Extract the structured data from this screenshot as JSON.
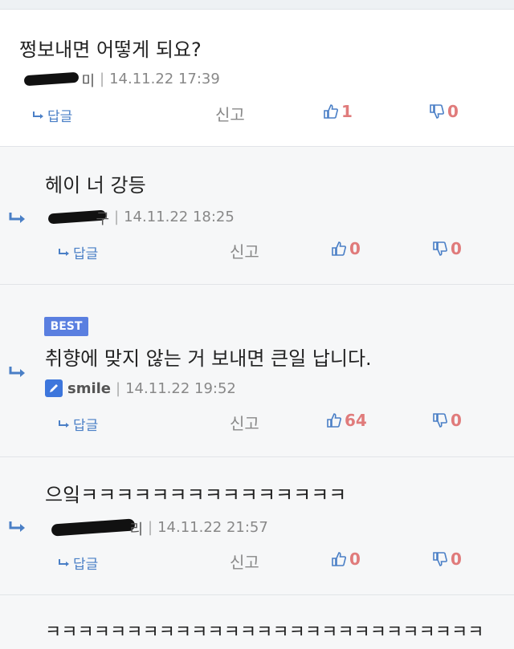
{
  "comments": [
    {
      "text": "쩡보내면 어떻게 되요?",
      "author_tail": "미",
      "date": "14.11.22 17:39",
      "reply_label": "답글",
      "report_label": "신고",
      "likes": "1",
      "dislikes": "0"
    },
    {
      "text": "헤이 너 강등",
      "author_tail": "구",
      "date": "14.11.22 18:25",
      "reply_label": "답글",
      "report_label": "신고",
      "likes": "0",
      "dislikes": "0"
    },
    {
      "badge": "BEST",
      "text": "취향에 맞지 않는 거 보내면 큰일 납니다.",
      "author": "smile",
      "date": "14.11.22 19:52",
      "reply_label": "답글",
      "report_label": "신고",
      "likes": "64",
      "dislikes": "0"
    },
    {
      "text": "으잌ㅋㅋㅋㅋㅋㅋㅋㅋㅋㅋㅋㅋㅋㅋㅋ",
      "author_tail": "리",
      "date": "14.11.22 21:57",
      "reply_label": "답글",
      "report_label": "신고",
      "likes": "0",
      "dislikes": "0"
    },
    {
      "text": "ㅋㅋㅋㅋㅋㅋㅋㅋㅋㅋㅋㅋㅋㅋㅋㅋㅋㅋㅋㅋㅋㅋㅋㅋㅋㅋㅋ"
    }
  ],
  "colors": {
    "accent": "#4a7fc6",
    "vote": "#e07b7b",
    "badge": "#5a7fe0"
  }
}
